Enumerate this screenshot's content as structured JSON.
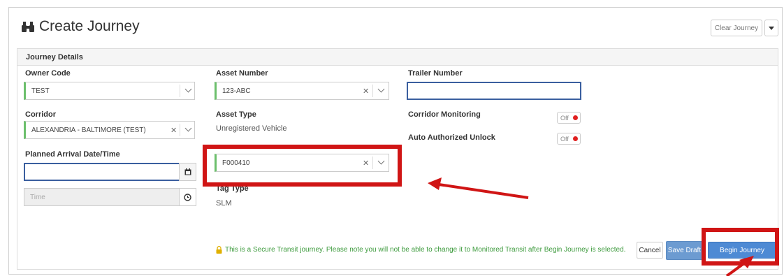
{
  "header": {
    "title": "Create Journey",
    "title_icon": "binoculars-icon",
    "clear_label": "Clear Journey"
  },
  "panel": {
    "title": "Journey Details"
  },
  "fields": {
    "owner_code": {
      "label": "Owner Code",
      "value": "TEST"
    },
    "corridor": {
      "label": "Corridor",
      "value": "ALEXANDRIA - BALTIMORE (TEST)"
    },
    "planned_arrival": {
      "label": "Planned Arrival Date/Time",
      "date_value": "",
      "time_placeholder": "Time"
    },
    "asset_number": {
      "label": "Asset Number",
      "value": "123-ABC"
    },
    "asset_type": {
      "label": "Asset Type",
      "value": "Unregistered Vehicle"
    },
    "tracking_tag": {
      "value": "F000410"
    },
    "tag_type": {
      "label": "Tag Type",
      "value": "SLM"
    },
    "trailer_number": {
      "label": "Trailer Number",
      "value": ""
    },
    "corridor_monitoring": {
      "label": "Corridor Monitoring",
      "state": "Off"
    },
    "auto_unlock": {
      "label": "Auto Authorized Unlock",
      "state": "Off"
    }
  },
  "footer": {
    "notice": "This is a Secure Transit journey. Please note you will not be able to change it to Monitored Transit after Begin Journey is selected.",
    "cancel_label": "Cancel",
    "save_draft_label": "Save Draft",
    "begin_label": "Begin Journey"
  },
  "colors": {
    "annotation": "#d01515",
    "primary": "#4e8ad4",
    "valid": "#6cbf6c",
    "notice": "#3c9a3c",
    "toggle_off": "#e02020"
  }
}
